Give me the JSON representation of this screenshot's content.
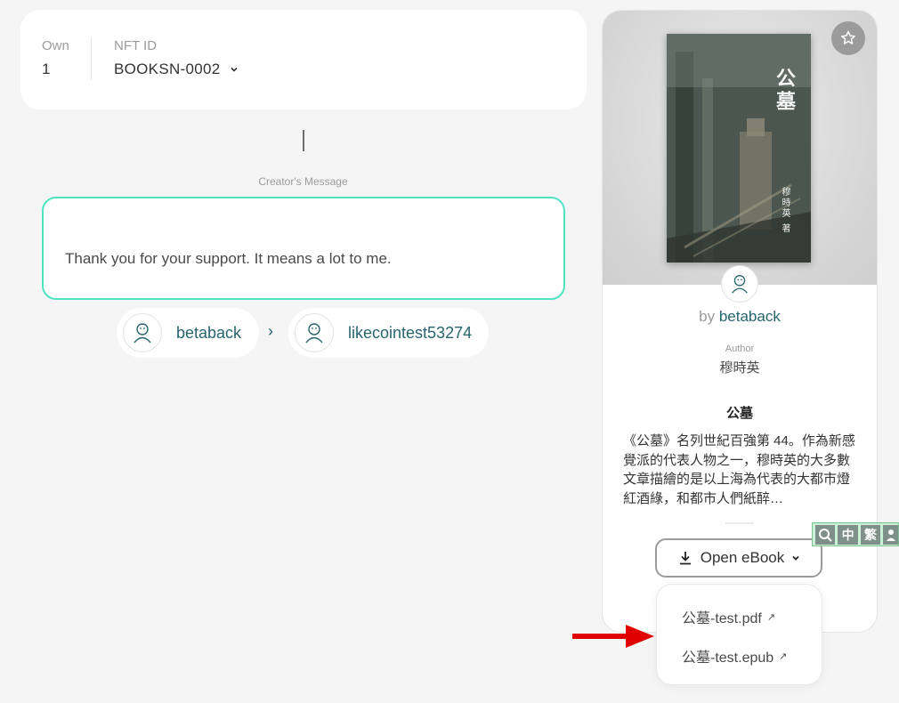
{
  "info": {
    "own_label": "Own",
    "own_value": "1",
    "nft_id_label": "NFT ID",
    "nft_id_value": "BOOKSN-0002"
  },
  "message": {
    "label": "Creator's Message",
    "text": "Thank you for your support. It means a lot to me."
  },
  "transfer": {
    "from": "betaback",
    "arrow": "›",
    "to": "likecointest53274"
  },
  "book": {
    "cover_title": "公墓",
    "cover_author": "穆時英 著",
    "by_prefix": "by",
    "creator": "betaback",
    "author_label": "Author",
    "author_name": "穆時英",
    "title": "公墓",
    "description": "《公墓》名列世紀百強第 44。作為新感覺派的代表人物之一，穆時英的大多數文章描繪的是以上海為代表的大都市燈紅酒綠，和都市人們紙醉…",
    "open_button": "Open eBook"
  },
  "files": [
    {
      "name": "公墓-test.pdf",
      "ext_icon": "↗"
    },
    {
      "name": "公墓-test.epub",
      "ext_icon": "↗"
    }
  ],
  "toolbar": {
    "btn1": "中",
    "btn2": "繁"
  },
  "colors": {
    "accent": "#50e3c2",
    "link": "#28646e",
    "arrow": "#e00000"
  }
}
